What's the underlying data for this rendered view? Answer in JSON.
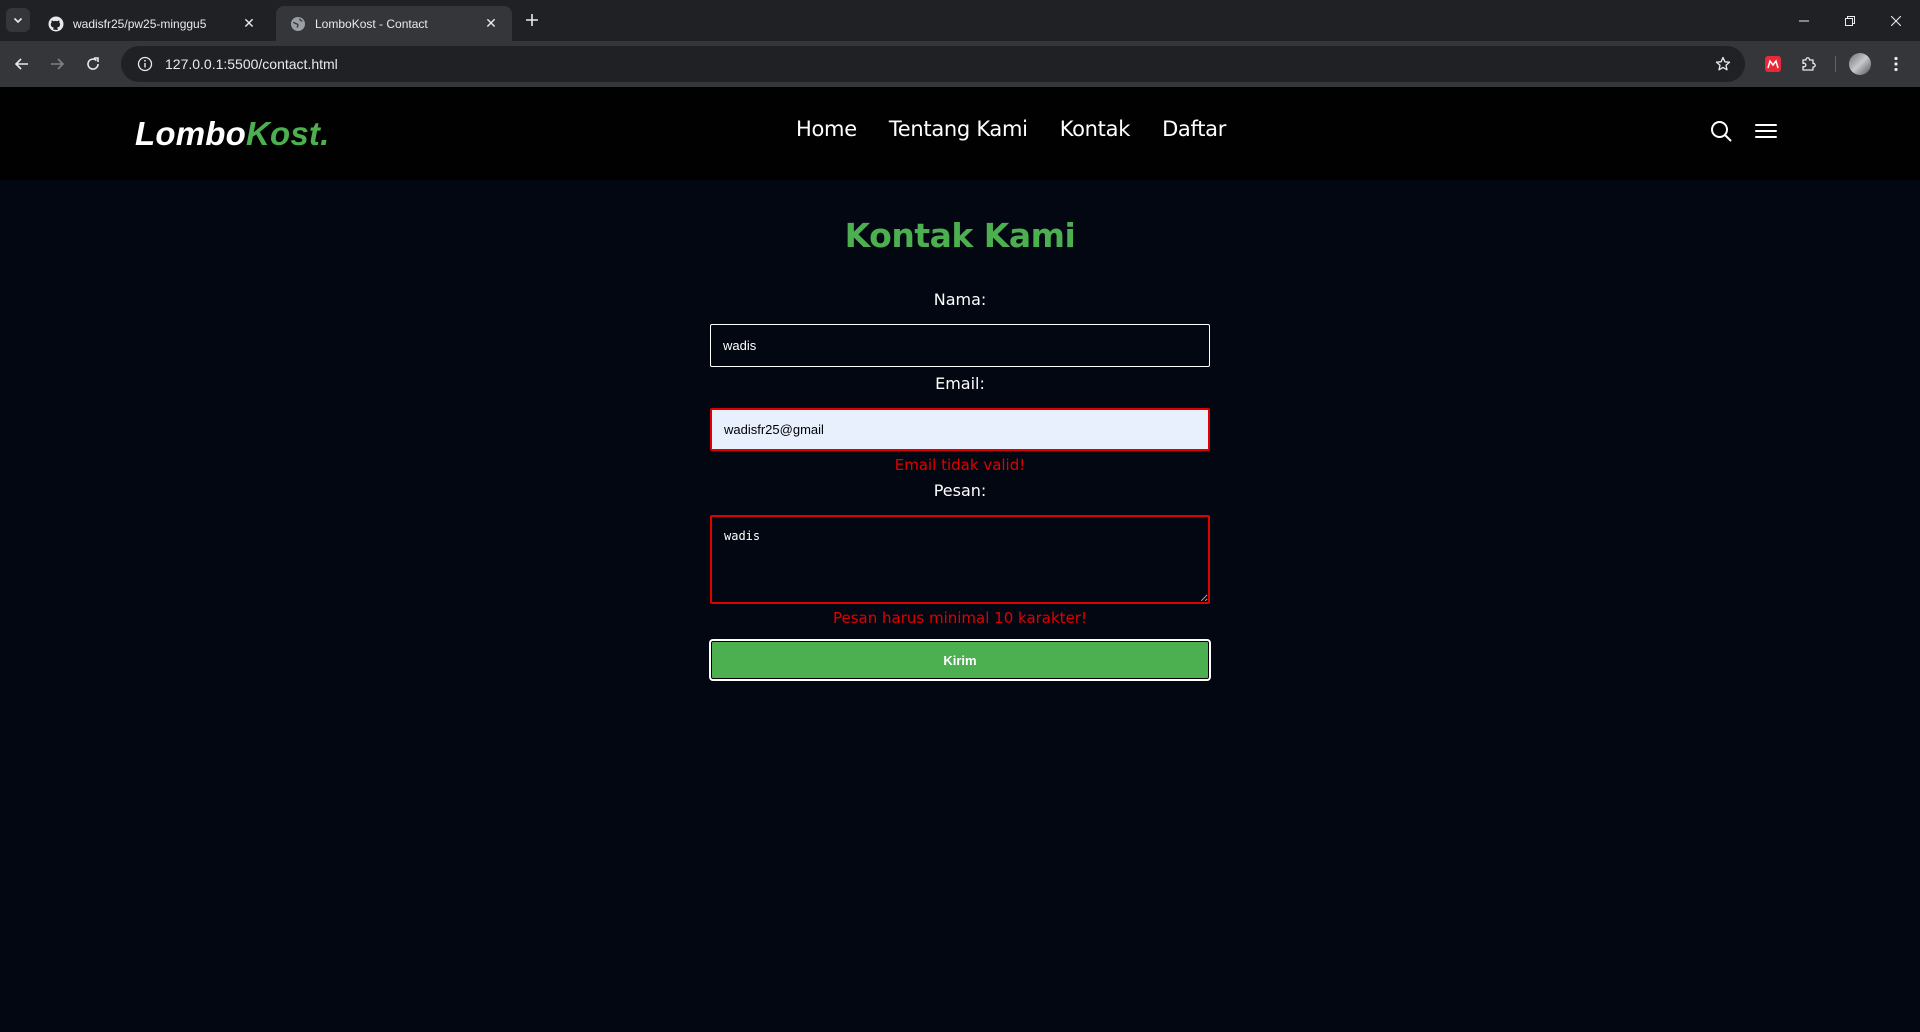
{
  "browser": {
    "tabs": [
      {
        "title": "wadisfr25/pw25-minggu5",
        "icon": "github-icon",
        "active": false
      },
      {
        "title": "LomboKost - Contact",
        "icon": "globe-icon",
        "active": true
      }
    ],
    "url": "127.0.0.1:5500/contact.html"
  },
  "site": {
    "logo": {
      "main": "Lombo",
      "accent": "Kost."
    },
    "menu": [
      "Home",
      "Tentang Kami",
      "Kontak",
      "Daftar"
    ],
    "accent_color": "#4caf50"
  },
  "contact": {
    "title": "Kontak Kami",
    "name_label": "Nama:",
    "name_value": "wadis",
    "email_label": "Email:",
    "email_value": "wadisfr25@gmail",
    "email_error": "Email tidak valid!",
    "message_label": "Pesan:",
    "message_value": "wadis",
    "message_error": "Pesan harus minimal 10 karakter!",
    "submit_label": "Kirim",
    "error_color": "#e00000"
  }
}
